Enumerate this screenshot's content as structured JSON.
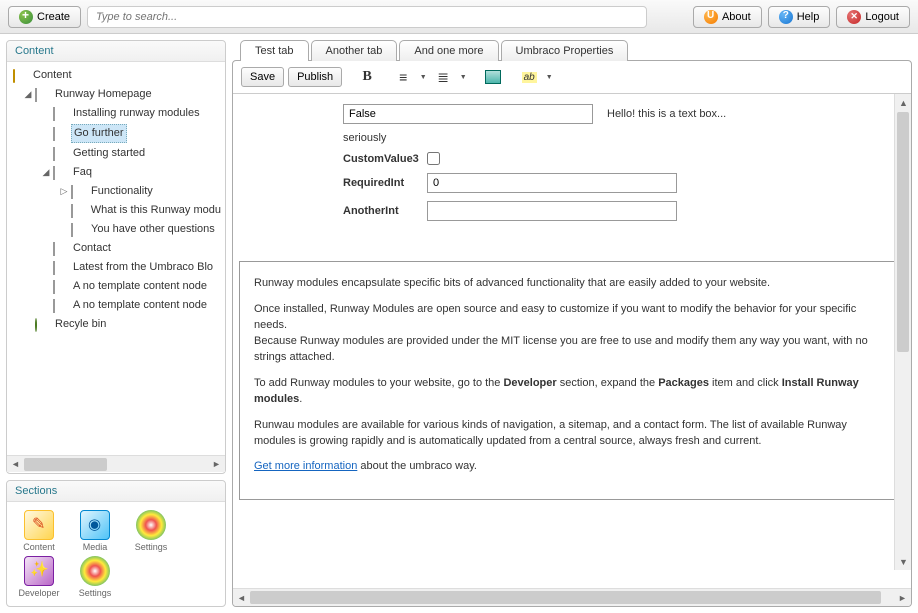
{
  "toolbar": {
    "create": "Create",
    "about": "About",
    "help": "Help",
    "logout": "Logout",
    "search_placeholder": "Type to search..."
  },
  "panels": {
    "content_title": "Content",
    "sections_title": "Sections"
  },
  "tree": {
    "root": "Content",
    "nodes": [
      {
        "label": "Runway Homepage",
        "level": 1,
        "expanded": true
      },
      {
        "label": "Installing runway modules",
        "level": 2
      },
      {
        "label": "Go further",
        "level": 2,
        "selected": true
      },
      {
        "label": "Getting started",
        "level": 2
      },
      {
        "label": "Faq",
        "level": 2,
        "expanded": true
      },
      {
        "label": "Functionality",
        "level": 3,
        "expandable": true
      },
      {
        "label": "What is this Runway modu",
        "level": 3
      },
      {
        "label": "You have other questions",
        "level": 3
      },
      {
        "label": "Contact",
        "level": 2
      },
      {
        "label": "Latest from the Umbraco Blo",
        "level": 2
      },
      {
        "label": "A no template content node",
        "level": 2
      },
      {
        "label": "A no template content node",
        "level": 2
      }
    ],
    "recycle": "Recyle bin"
  },
  "sections": [
    {
      "label": "Content",
      "kind": "content"
    },
    {
      "label": "Media",
      "kind": "media"
    },
    {
      "label": "Settings",
      "kind": "settings"
    },
    {
      "label": "Developer",
      "kind": "developer"
    },
    {
      "label": "Settings",
      "kind": "settings"
    }
  ],
  "tabs": [
    "Test tab",
    "Another tab",
    "And one more",
    "Umbraco Properties"
  ],
  "editor": {
    "save": "Save",
    "publish": "Publish"
  },
  "form": {
    "field1_value": "False",
    "field1_aside": "Hello! this is a text box...",
    "seriously": "seriously",
    "customvalue3_label": "CustomValue3",
    "requiredint_label": "RequiredInt",
    "requiredint_value": "0",
    "anotherint_label": "AnotherInt",
    "anotherint_value": ""
  },
  "rte": {
    "p1": "Runway modules encapsulate specific bits of advanced functionality that are easily added to your website.",
    "p2": "Once installed, Runway Modules are open source and easy to customize if you want to modify the behavior for your specific needs.",
    "p3": "Because Runway modules are provided under the MIT license you are free to use and modify them any way you want, with no strings attached.",
    "p4_pre": "To add Runway modules to your website, go to the ",
    "p4_b1": "Developer",
    "p4_mid1": " section, expand the ",
    "p4_b2": "Packages",
    "p4_mid2": " item and click ",
    "p4_b3": "Install Runway modules",
    "p4_post": ".",
    "p5": "Runwau modules are available for various kinds of navigation, a sitemap, and a contact form. The list of available Runway modules is growing rapidly and is automatically updated from a central source, always fresh and current.",
    "link": "Get more information",
    "link_after": " about the umbraco way."
  }
}
